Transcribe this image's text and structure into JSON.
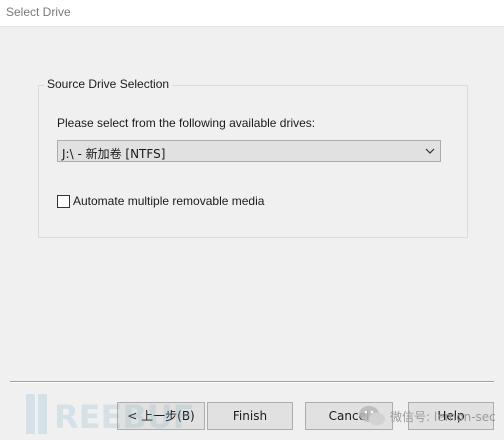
{
  "window": {
    "title": "Select Drive"
  },
  "group": {
    "label": "Source Drive Selection",
    "prompt": "Please select from the following available drives:",
    "drive_select": {
      "selected": "J:\\ - 新加卷 [NTFS]"
    },
    "automate_checkbox": {
      "label": "Automate multiple removable media",
      "checked": false
    }
  },
  "buttons": {
    "back": "< 上一步(B)",
    "finish": "Finish",
    "cancel": "Cancel",
    "help": "Help"
  },
  "watermark": {
    "freebuf": "FREEBUF",
    "wechat": "微信号: lemon-sec"
  },
  "colors": {
    "window_bg": "#f0f0f0",
    "titlebar_bg": "#ffffff",
    "button_bg": "#e1e1e1",
    "border": "#adadad"
  }
}
